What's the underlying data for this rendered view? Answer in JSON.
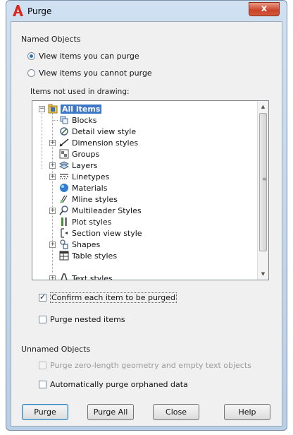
{
  "window": {
    "title": "Purge",
    "close_label": "x"
  },
  "named_objects": {
    "heading": "Named Objects",
    "radio_can_purge": "View items you can purge",
    "radio_cannot_purge": "View items you cannot purge",
    "selected_radio": "can_purge",
    "list_label": "Items not used in drawing:",
    "tree": {
      "root": "All items",
      "items": [
        "Blocks",
        "Detail view style",
        "Dimension styles",
        "Groups",
        "Layers",
        "Linetypes",
        "Materials",
        "Mline styles",
        "Multileader Styles",
        "Plot styles",
        "Section view style",
        "Shapes",
        "Table styles",
        "Text styles"
      ]
    },
    "confirm_label": "Confirm each item to be purged",
    "confirm_checked": true,
    "nested_label": "Purge nested items",
    "nested_checked": false
  },
  "unnamed_objects": {
    "heading": "Unnamed Objects",
    "zero_length_label": "Purge zero-length geometry and empty text objects",
    "zero_length_enabled": false,
    "orphaned_label": "Automatically purge orphaned data",
    "orphaned_checked": false
  },
  "buttons": {
    "purge": "Purge",
    "purge_all": "Purge All",
    "close": "Close",
    "help": "Help"
  },
  "colors": {
    "accent": "#3c77c8",
    "title_logo": "#d62a1e",
    "close_button": "#c9432a"
  }
}
